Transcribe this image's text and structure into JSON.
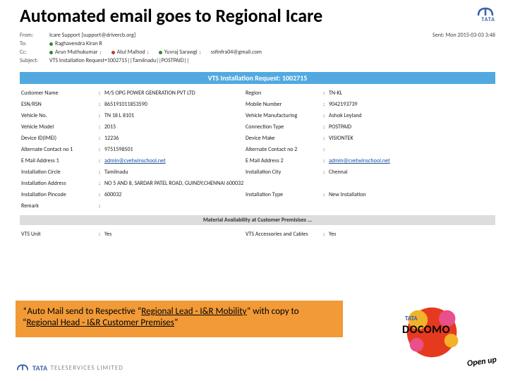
{
  "title": "Automated email goes to Regional Icare",
  "email": {
    "from_label": "From:",
    "to_label": "To:",
    "cc_label": "Cc:",
    "subject_label": "Subject:",
    "from": "Icare Support [support@drivercb.org]",
    "to1": "Raghavendra Kiran R",
    "cc1": "Arun Muthukumar",
    "cc2": "Atul Malhod",
    "cc3": "Yuvraj Sarawgi",
    "cc4": "ssfinfra04@gmail.com",
    "subject": "VTS Installation Request=1002715||Tamilnadu||POSTPAID||",
    "sent_label": "Sent:",
    "sent": "Mon 2015-03-03 3:48"
  },
  "bluebar": "VTS Installation Request: 1002715",
  "rows": {
    "customer_l": "Customer Name",
    "customer_v": "M/S OPG POWER GENERATION PVT LTD",
    "region_l": "Region",
    "region_v": "TN-KL",
    "esn_l": "ESN/RSN",
    "esn_v": "865191011853590",
    "mobile_l": "Mobile Number",
    "mobile_v": "9042193739",
    "vno_l": "Vehicle No.",
    "vno_v": "TN 18 L 8101",
    "vmfg_l": "Vehicle Manufacturing",
    "vmfg_v": "Ashok Leyland",
    "vmodel_l": "Vehicle Model",
    "vmodel_v": "2015",
    "conn_l": "Connection Type",
    "conn_v": "POSTPAID",
    "imei_l": "Device ID(IMEI)",
    "imei_v": "12236",
    "dmake_l": "Device Make",
    "dmake_v": "VISIONTEK",
    "alt1_l": "Alternate Contact no 1",
    "alt1_v": "9751598501",
    "alt2_l": "Alternate Contact no 2",
    "alt2_v": "",
    "email1_l": "E Mail Address 1",
    "email1_v": "admin@cvetwinschool.net",
    "email2_l": "E Mail Address 2",
    "email2_v": "admin@cvetwinschool.net",
    "circle_l": "Installation Circle",
    "circle_v": "Tamilnadu",
    "city_l": "Installation City",
    "city_v": "Chennai",
    "addr_l": "Installation Address",
    "addr_v": "NO 5 AND 8, SARDAR PATEL ROAD, GUINDY,CHENNAI 600032",
    "pin_l": "Installation Pincode",
    "pin_v": "600032",
    "itype_l": "Installation Type",
    "itype_v": "New Installation",
    "remark_l": "Remark",
    "remark_v": ""
  },
  "graybar": "Material Availability at Customer Premisises ...",
  "mat": {
    "unit_l": "VTS Unit",
    "unit_v": "Yes",
    "acc_l": "VTS Accessories and Cables",
    "acc_v": "Yes"
  },
  "orange": {
    "prefix": "*Auto Mail send to Respective “",
    "u1": "Regional Lead - I&R Mobility",
    "mid": "” with copy to “",
    "u2": "Regional Head - I&R Customer Premises",
    "suffix": "”"
  },
  "footer": {
    "brand": "TATA",
    "sub": "TELESERVICES LIMITED"
  },
  "docomo": {
    "brand": "TATA",
    "main": "DOCOMO",
    "openup": "Open up"
  }
}
